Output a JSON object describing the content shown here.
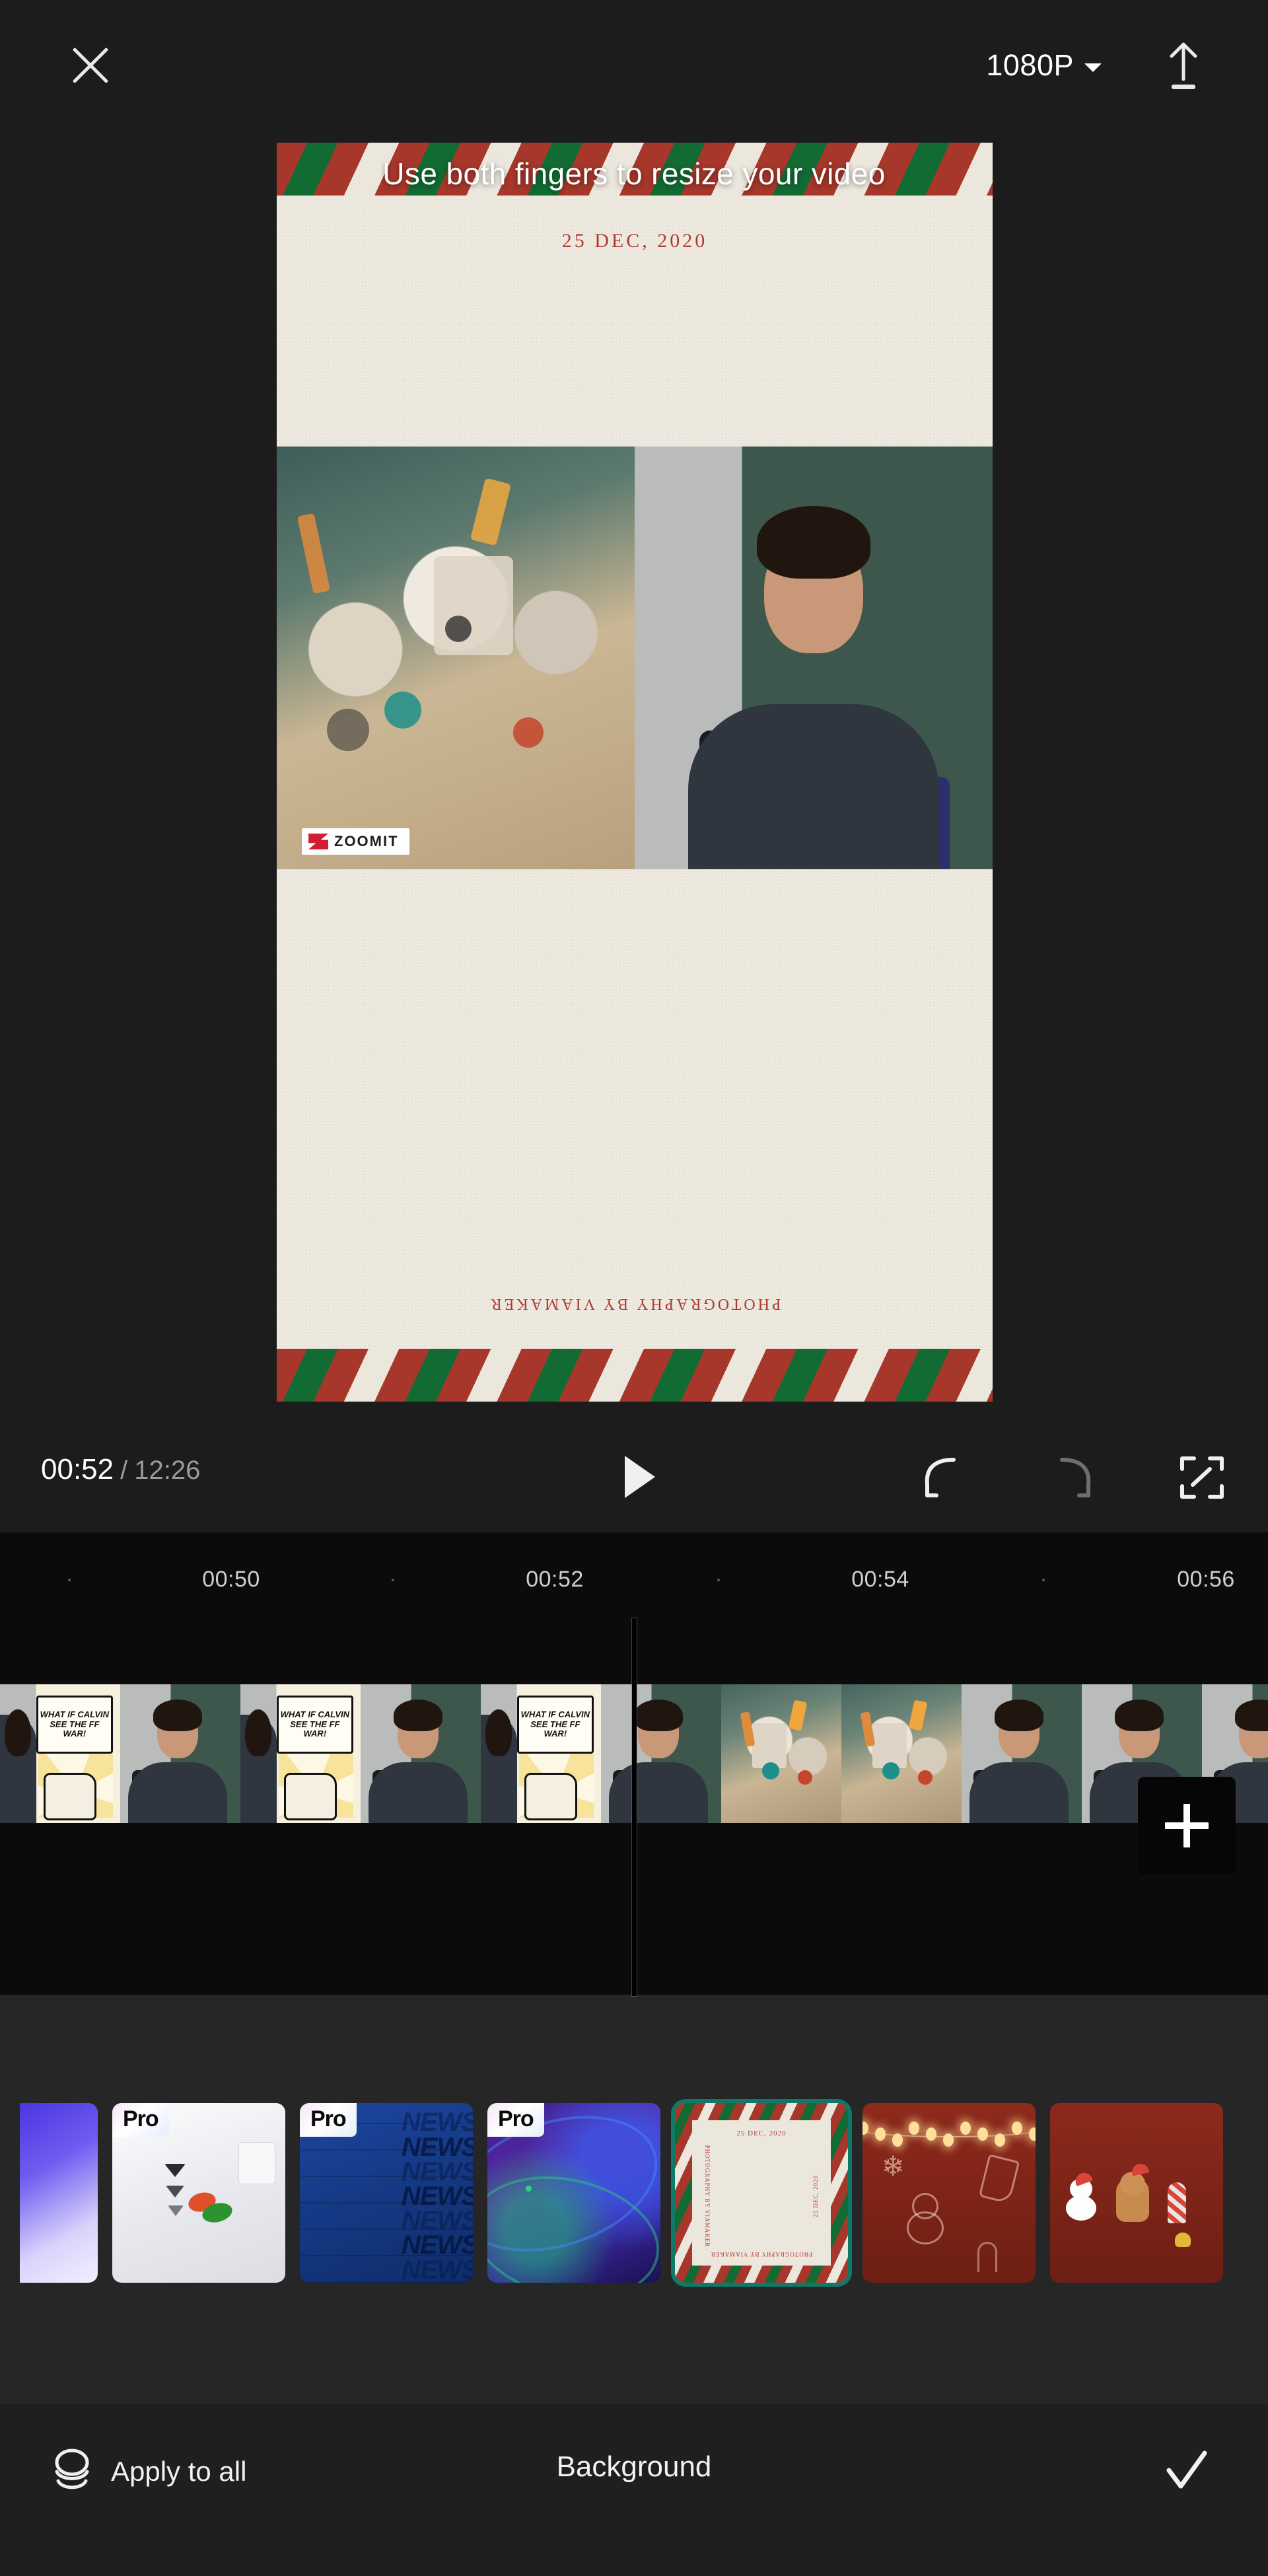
{
  "topbar": {
    "close_icon": "close-icon",
    "resolution": "1080P",
    "caret_icon": "chevron-down-icon",
    "export_icon": "upload-icon"
  },
  "preview": {
    "overlay_caption": "Use both fingers to resize your video",
    "card_date": "25 DEC, 2020",
    "card_credit": "PHOTOGRAPHY BY VIAMAKER",
    "watermark_text": "ZOOMIT",
    "watermark_mark": "z-logo-icon",
    "frame_colors": {
      "paper": "#ece7dd",
      "stripe_red": "#a6372a",
      "stripe_green": "#126b33",
      "ink_red": "#b03a32"
    }
  },
  "transport": {
    "current_time": "00:52",
    "separator": "/",
    "total_time": "12:26",
    "play_icon": "play-icon",
    "undo_icon": "undo-icon",
    "redo_icon": "redo-icon",
    "fullscreen_icon": "fullscreen-icon"
  },
  "timeline": {
    "ruler_labels": [
      "00:50",
      "00:52",
      "00:54",
      "00:56"
    ],
    "ruler_positions": [
      350,
      840,
      1333,
      1826
    ],
    "tick_positions": [
      105,
      595,
      1088,
      1580
    ],
    "playhead_time": "00:52",
    "add_clip_icon": "plus-icon",
    "clips": [
      {
        "kind": "comic",
        "width": 182,
        "caption": "WHAT IF CALVIN SEE THE FF WAR!"
      },
      {
        "kind": "face",
        "width": 182,
        "caption": ""
      },
      {
        "kind": "comic",
        "width": 182,
        "caption": "WHAT IF CALVIN SEE THE FF WAR!"
      },
      {
        "kind": "face",
        "width": 182,
        "caption": ""
      },
      {
        "kind": "comic",
        "width": 182,
        "caption": "WHAT IF CALVIN SEE THE FF WAR!"
      },
      {
        "kind": "face",
        "width": 182,
        "caption": ""
      },
      {
        "kind": "robot",
        "width": 182,
        "caption": ""
      },
      {
        "kind": "robot",
        "width": 182,
        "caption": ""
      },
      {
        "kind": "face",
        "width": 182,
        "caption": ""
      },
      {
        "kind": "face",
        "width": 182,
        "caption": ""
      },
      {
        "kind": "face",
        "width": 182,
        "caption": ""
      }
    ]
  },
  "background_picker": {
    "items": [
      {
        "id": "gradient-purple",
        "name": "purple-gradient-background",
        "pro": false,
        "selected": false,
        "style": "bgp1"
      },
      {
        "id": "pro-white-card",
        "name": "white-tools-background",
        "pro": true,
        "pro_label": "Pro",
        "selected": false,
        "style": "bgp2"
      },
      {
        "id": "pro-news-blue",
        "name": "blue-news-background",
        "pro": true,
        "pro_label": "Pro",
        "selected": false,
        "style": "bgp3",
        "news_lines": [
          "NEWS",
          "NEWS",
          "NEWS",
          "NEWS",
          "NEWS",
          "NEWS",
          "NEWS"
        ]
      },
      {
        "id": "pro-purple-swirl",
        "name": "purple-swirl-background",
        "pro": true,
        "pro_label": "Pro",
        "selected": false,
        "style": "bgp4"
      },
      {
        "id": "candy-frame",
        "name": "candy-stripe-frame-background",
        "pro": false,
        "selected": true,
        "style": "bgp5",
        "mini_date": "25 DEC, 2020",
        "mini_credit": "PHOTOGRAPHY BY VIAMAKER"
      },
      {
        "id": "xmas-lights",
        "name": "christmas-lights-background",
        "pro": false,
        "selected": false,
        "style": "bgp6"
      },
      {
        "id": "xmas-stickers",
        "name": "christmas-stickers-background",
        "pro": false,
        "selected": false,
        "style": "bgp7"
      }
    ],
    "selection_color": "#11796a"
  },
  "bottombar": {
    "apply_all_label": "Apply to all",
    "apply_all_icon": "layers-stack-icon",
    "panel_title": "Background",
    "confirm_icon": "check-icon"
  }
}
